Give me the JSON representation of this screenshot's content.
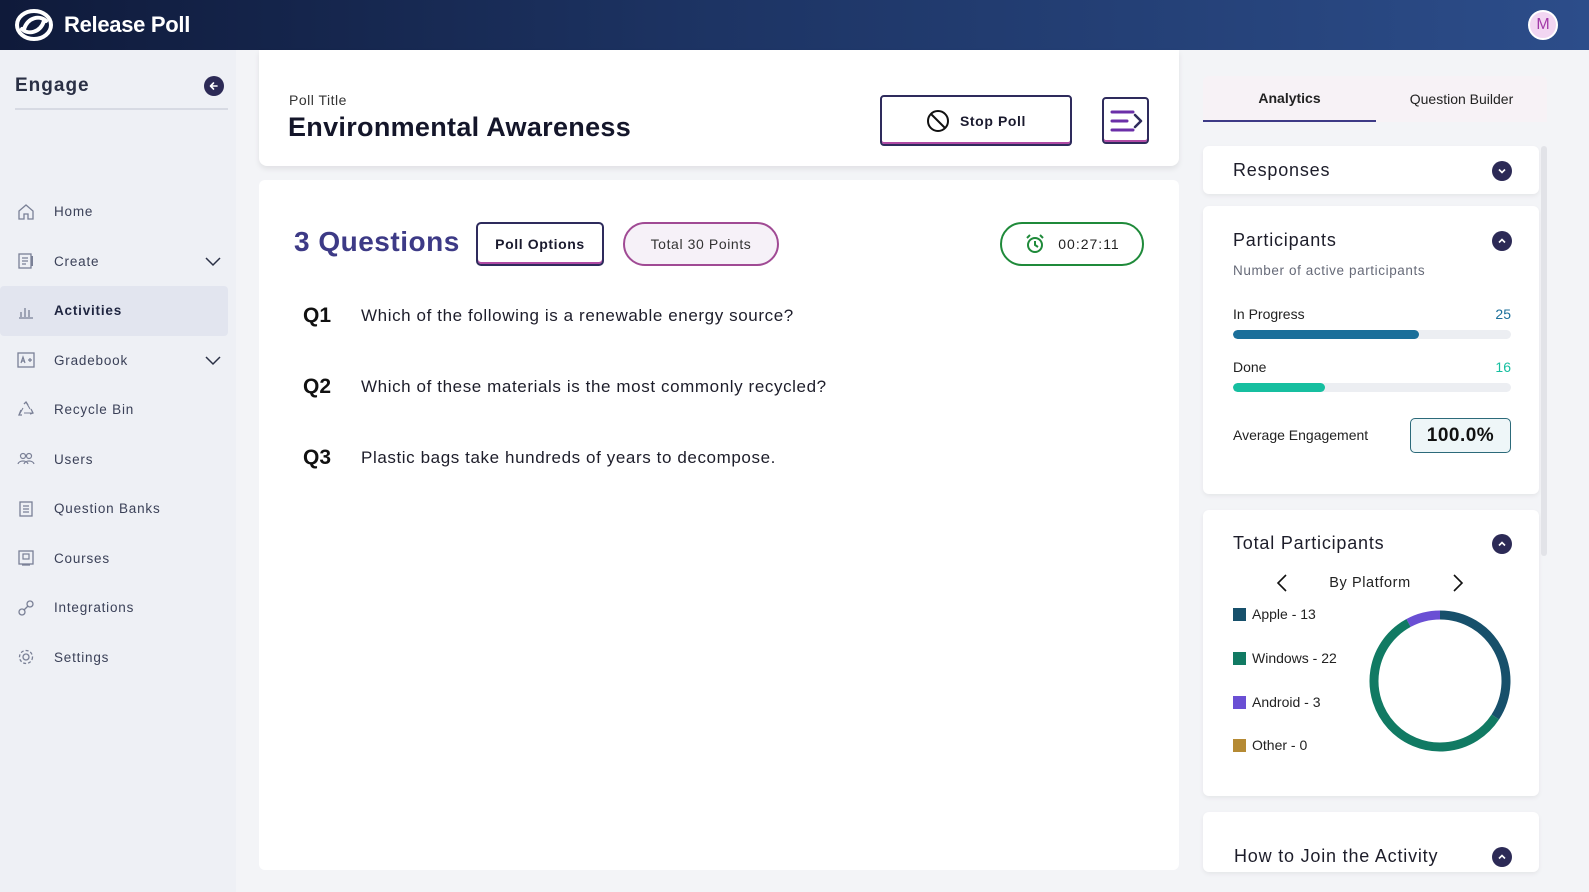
{
  "app": {
    "name": "Release Poll",
    "avatar_initial": "M"
  },
  "sidebar": {
    "title": "Engage",
    "items": [
      {
        "label": "Home",
        "icon": "home-icon",
        "expandable": false,
        "active": false
      },
      {
        "label": "Create",
        "icon": "create-icon",
        "expandable": true,
        "active": false
      },
      {
        "label": "Activities",
        "icon": "activities-icon",
        "expandable": false,
        "active": true
      },
      {
        "label": "Gradebook",
        "icon": "gradebook-icon",
        "expandable": true,
        "active": false
      },
      {
        "label": "Recycle Bin",
        "icon": "recycle-icon",
        "expandable": false,
        "active": false
      },
      {
        "label": "Users",
        "icon": "users-icon",
        "expandable": false,
        "active": false
      },
      {
        "label": "Question Banks",
        "icon": "question-bank-icon",
        "expandable": false,
        "active": false
      },
      {
        "label": "Courses",
        "icon": "courses-icon",
        "expandable": false,
        "active": false
      },
      {
        "label": "Integrations",
        "icon": "integrations-icon",
        "expandable": false,
        "active": false
      },
      {
        "label": "Settings",
        "icon": "gear-icon",
        "expandable": false,
        "active": false
      }
    ]
  },
  "poll": {
    "label": "Poll Title",
    "title": "Environmental Awareness",
    "stop_label": "Stop Poll",
    "question_count_label": "3 Questions",
    "options_label": "Poll Options",
    "points_label": "Total 30 Points",
    "timer": "00:27:11",
    "questions": [
      {
        "num": "Q1",
        "text": "Which of the following is a renewable energy source?"
      },
      {
        "num": "Q2",
        "text": "Which of these materials is the most commonly recycled?"
      },
      {
        "num": "Q3",
        "text": "Plastic bags take hundreds of years to decompose."
      }
    ]
  },
  "panel": {
    "tabs": [
      "Analytics",
      "Question Builder"
    ],
    "responses_title": "Responses",
    "participants": {
      "title": "Participants",
      "subtitle": "Number of active participants",
      "in_progress_label": "In Progress",
      "in_progress_value": 25,
      "in_progress_fill": 0.67,
      "done_label": "Done",
      "done_value": 16,
      "done_fill": 0.33,
      "avg_label": "Average Engagement",
      "avg_value": "100.0%"
    },
    "total": {
      "title": "Total Participants",
      "group_label": "By Platform",
      "legend": [
        {
          "label": "Apple - 13",
          "value": 13,
          "color": "#17506b"
        },
        {
          "label": "Windows - 22",
          "value": 22,
          "color": "#117a63"
        },
        {
          "label": "Android - 3",
          "value": 3,
          "color": "#6a4fd4"
        },
        {
          "label": "Other - 0",
          "value": 0,
          "color": "#b58a34"
        }
      ]
    },
    "join_title": "How to Join the Activity"
  },
  "colors": {
    "in_progress": "#1b6f9a",
    "done": "#16bfa0",
    "accent": "#3d3a86"
  }
}
